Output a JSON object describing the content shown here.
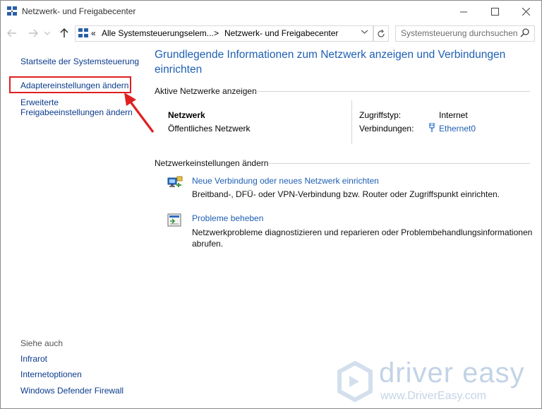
{
  "window": {
    "title": "Netzwerk- und Freigabecenter"
  },
  "address_bar": {
    "chevrons": "«",
    "segment1": "Alle Systemsteuerungselem...",
    "separator": ">",
    "segment2": "Netzwerk- und Freigabecenter",
    "search_placeholder": "Systemsteuerung durchsuchen"
  },
  "sidebar": {
    "home": "Startseite der Systemsteuerung",
    "adapter": "Adaptereinstellungen ändern",
    "advanced_line1": "Erweiterte",
    "advanced_line2": "Freigabeeinstellungen ändern",
    "see_also": "Siehe auch",
    "links": [
      "Infrarot",
      "Internetoptionen",
      "Windows Defender Firewall"
    ]
  },
  "main": {
    "title_line1": "Grundlegende Informationen zum Netzwerk anzeigen und Verbindungen",
    "title_line2": "einrichten",
    "active_header": "Aktive Netzwerke anzeigen",
    "network_name": "Netzwerk",
    "network_type": "Öffentliches Netzwerk",
    "access_label": "Zugriffstyp:",
    "access_value": "Internet",
    "connections_label": "Verbindungen:",
    "connections_value": "Ethernet0",
    "change_header": "Netzwerkeinstellungen ändern",
    "task1_link": "Neue Verbindung oder neues Netzwerk einrichten",
    "task1_desc": "Breitband-, DFÜ- oder VPN-Verbindung bzw. Router oder Zugriffspunkt einrichten.",
    "task2_link": "Probleme beheben",
    "task2_desc_line1": "Netzwerkprobleme diagnostizieren und reparieren oder Problembehandlungsinformationen",
    "task2_desc_line2": "abrufen."
  },
  "watermark": {
    "brand": "driver easy",
    "url": "www.DriverEasy.com"
  },
  "colors": {
    "link": "#1e5fb4",
    "highlight": "#e02020"
  }
}
